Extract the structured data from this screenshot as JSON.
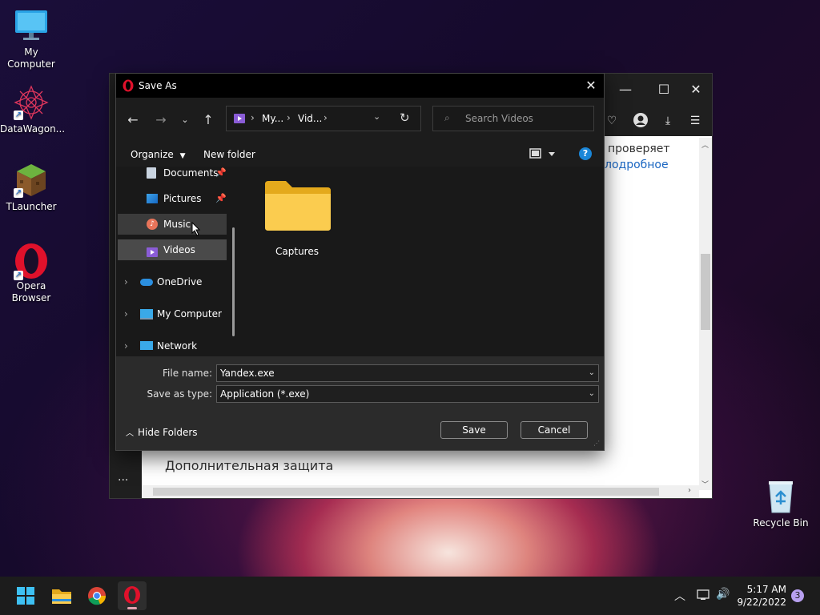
{
  "desktop": {
    "icons": [
      {
        "label": "My Computer",
        "icon": "monitor-icon"
      },
      {
        "label": "DataWagon...",
        "icon": "datawagon-icon"
      },
      {
        "label": "TLauncher",
        "icon": "tlauncher-icon"
      },
      {
        "label": "Opera Browser",
        "icon": "opera-icon"
      },
      {
        "label": "Recycle Bin",
        "icon": "recycle-bin-icon"
      }
    ]
  },
  "browser": {
    "text1": "проверяет",
    "text2": "лодробное",
    "section_heading": "Дополнительная защита",
    "more_label": "···"
  },
  "dialog": {
    "title": "Save As",
    "breadcrumb": [
      "My...",
      "Vid..."
    ],
    "search_placeholder": "Search Videos",
    "organize_label": "Organize",
    "new_folder_label": "New folder",
    "nav_items": [
      {
        "label": "Documents",
        "icon": "documents-icon",
        "pinned": true
      },
      {
        "label": "Pictures",
        "icon": "pictures-icon",
        "pinned": true
      },
      {
        "label": "Music",
        "icon": "music-icon",
        "state": "hover"
      },
      {
        "label": "Videos",
        "icon": "videos-icon",
        "state": "selected"
      },
      {
        "label": "OneDrive",
        "icon": "onedrive-icon"
      },
      {
        "label": "My Computer",
        "icon": "computer-icon"
      },
      {
        "label": "Network",
        "icon": "network-icon"
      }
    ],
    "folder": {
      "name": "Captures"
    },
    "file_name_label": "File name:",
    "file_name_value": "Yandex.exe",
    "save_type_label": "Save as type:",
    "save_type_value": "Application (*.exe)",
    "hide_folders_label": "Hide Folders",
    "save_label": "Save",
    "cancel_label": "Cancel"
  },
  "taskbar": {
    "apps": [
      "windows-start-icon",
      "file-explorer-icon",
      "chrome-icon",
      "opera-icon"
    ],
    "time": "5:17 AM",
    "date": "9/22/2022",
    "notification_count": "3"
  },
  "colors": {
    "accent": "#0078d4",
    "folder": "#f6c544",
    "opera_red": "#e0112b"
  }
}
